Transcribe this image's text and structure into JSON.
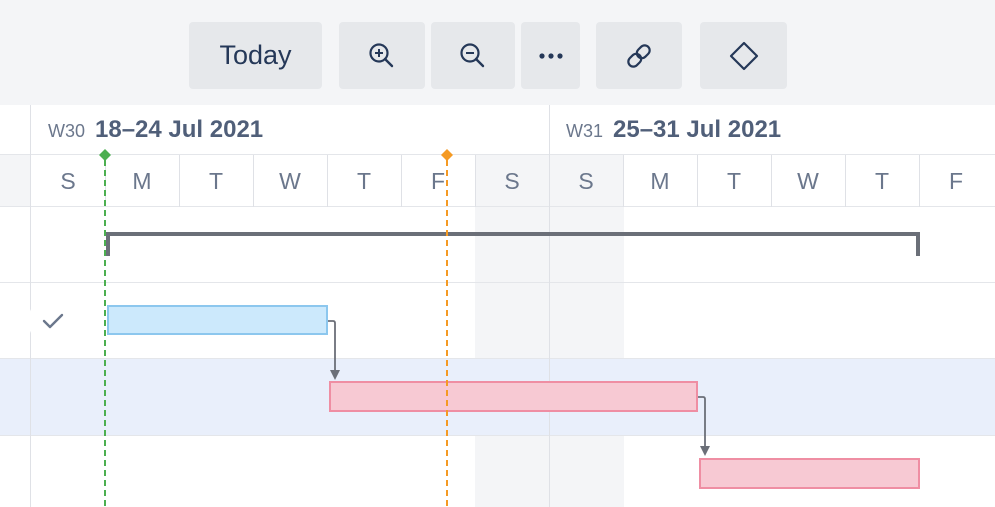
{
  "toolbar": {
    "today_label": "Today",
    "buttons": [
      {
        "name": "zoom-in",
        "icon": "zoom-in-icon"
      },
      {
        "name": "zoom-out",
        "icon": "zoom-out-icon"
      },
      {
        "name": "more",
        "icon": "more-dots-icon"
      },
      {
        "name": "link",
        "icon": "link-icon"
      },
      {
        "name": "milestone",
        "icon": "diamond-icon"
      }
    ]
  },
  "timeline": {
    "weeks": [
      {
        "number": "W30",
        "range": "18–24 Jul 2021"
      },
      {
        "number": "W31",
        "range": "25–31 Jul 2021"
      }
    ],
    "days": [
      "S",
      "M",
      "T",
      "W",
      "T",
      "F",
      "S",
      "S",
      "M",
      "T",
      "W",
      "T",
      "F"
    ]
  },
  "colors": {
    "today_marker": "#4caf50",
    "milestone_marker": "#f59a23",
    "task_blue": "#cce9fc",
    "task_red": "#f7c9d3",
    "group_bracket": "#6b6f78",
    "row_highlight": "#e9effb"
  }
}
